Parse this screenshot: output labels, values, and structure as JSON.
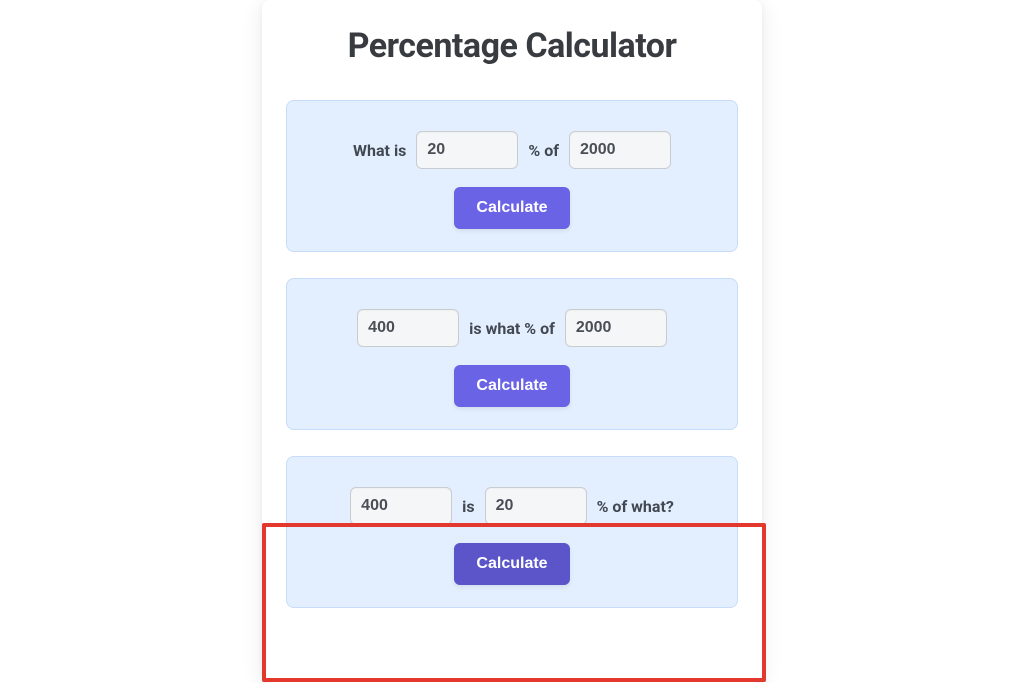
{
  "title": "Percentage Calculator",
  "panel1": {
    "label_before": "What is",
    "input1": "20",
    "label_mid": "%  of",
    "input2": "2000",
    "button": "Calculate"
  },
  "panel2": {
    "input1": "400",
    "label_mid": "is what % of",
    "input2": "2000",
    "button": "Calculate"
  },
  "panel3": {
    "input1": "400",
    "label_mid": "is",
    "input2": "20",
    "label_after": "% of what?",
    "button": "Calculate"
  }
}
